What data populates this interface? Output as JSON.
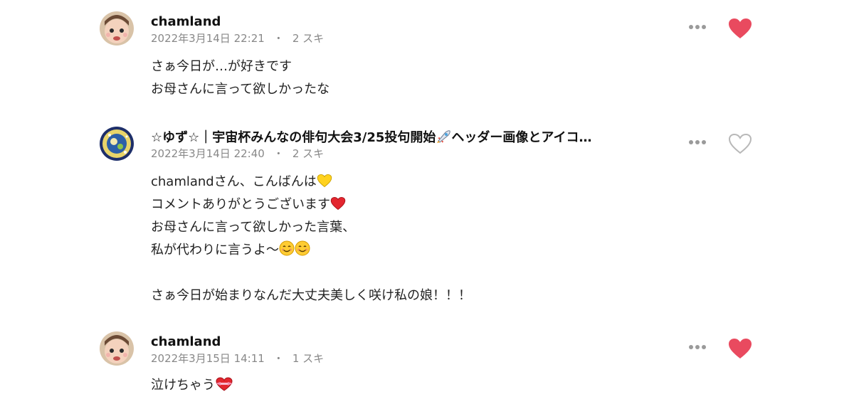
{
  "comments": [
    {
      "author": "chamland",
      "date": "2022年3月14日 22:21",
      "separator": "・",
      "likes": "2 スキ",
      "liked": true,
      "lines": [
        "さぁ今日が…が好きです",
        "お母さんに言って欲しかったな"
      ]
    },
    {
      "author": "☆ゆず☆｜宇宙杯みんなの俳句大会3/25投句開始🚀ヘッダー画像とアイコ…",
      "author_part1": "☆ゆず☆｜宇宙杯みんなの俳句大会3/25投句開始",
      "author_part2": "ヘッダー画像とアイコ…",
      "date": "2022年3月14日 22:40",
      "separator": "・",
      "likes": "2 スキ",
      "liked": false,
      "lines": [
        "chamlandさん、こんばんは",
        "コメントありがとうございます",
        "お母さんに言って欲しかった言葉、",
        "私が代わりに言うよ〜",
        "",
        "さぁ今日が始まりなんだ大丈夫美しく咲け私の娘！！！"
      ]
    },
    {
      "author": "chamland",
      "date": "2022年3月15日 14:11",
      "separator": "・",
      "likes": "1 スキ",
      "liked": true,
      "lines": [
        "泣けちゃう"
      ]
    }
  ],
  "icons": {
    "more": "more-dots-icon",
    "like_filled": "heart-filled-icon",
    "like_outline": "heart-outline-icon",
    "rocket": "rocket-emoji",
    "yellow_heart": "yellow-heart-emoji",
    "red_heart": "red-heart-emoji",
    "smile": "smiling-face-emoji",
    "heart_ribbon": "heart-with-ribbon-emoji"
  },
  "colors": {
    "like_active": "#e94a5f",
    "like_inactive": "#b8b8b8",
    "more": "#9a9a9a",
    "meta_text": "#888888"
  }
}
